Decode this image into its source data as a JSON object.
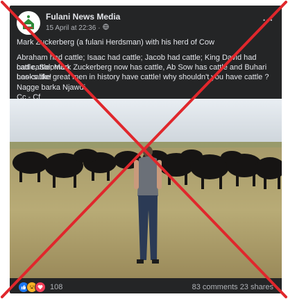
{
  "post": {
    "page_name": "Fulani News Media",
    "timestamp": "15 April at 22:36",
    "audience_icon": "globe-icon",
    "more_icon": "more-options-icon",
    "more_label": "...",
    "text_lines": {
      "line1": "Mark Zuckerberg (a fulani Herdsman) with his herd of Cow",
      "line2": "Abraham had cattle; Isaac had cattle; Jacob had cattle; King David had cattle, Solomon",
      "line3": "had cattle; Mark Zuckerberg now has cattle, Ab Sow  has cattle and Buhari has cattle!",
      "line4": "Looks like great men in history have cattle! why shouldn't you have cattle ?",
      "line5": "Nagge barka Njawdi",
      "line6": "Cc - Cf"
    }
  },
  "footer": {
    "reaction_icons": [
      "like-icon",
      "haha-icon",
      "love-icon"
    ],
    "reaction_count": "108",
    "comments": "83 comments",
    "shares": "23 shares"
  },
  "overlay": {
    "mark_color": "#e0272c",
    "mark": "cross-out-x"
  },
  "colors": {
    "card_bg": "#242526",
    "text": "#e4e6eb",
    "muted": "#b0b3b8",
    "like_blue": "#1877f2",
    "haha_yellow": "#f7b125",
    "love_red": "#f33e58"
  }
}
